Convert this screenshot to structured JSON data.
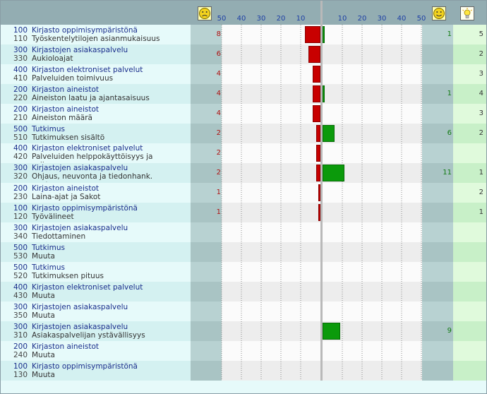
{
  "chart_data": {
    "type": "bar",
    "orientation": "diverging-horizontal",
    "axis_ticks": [
      50,
      40,
      30,
      20,
      10
    ],
    "axis_ticks_right": [
      10,
      20,
      30,
      40,
      50
    ],
    "xlim": [
      0,
      50
    ],
    "legend": {
      "negative": "sad-face-icon",
      "positive": "smiley-face-icon",
      "ideas": "lightbulb-icon"
    },
    "rows": [
      {
        "code1": "100",
        "cat": "Kirjasto oppimisympäristönä",
        "code2": "110",
        "sub": [
          "Työskentelytilojen asianmukaisuus"
        ],
        "neg": 8,
        "pos": 1,
        "ideas": 5
      },
      {
        "code1": "300",
        "cat": "Kirjastojen asiakaspalvelu",
        "code2": "330",
        "sub": [
          "Aukioloajat"
        ],
        "neg": 6,
        "pos": null,
        "ideas": 2
      },
      {
        "code1": "400",
        "cat": "Kirjaston elektroniset palvelut",
        "code2": "410",
        "sub": [
          "Palveluiden toimivuus"
        ],
        "neg": 4,
        "pos": null,
        "ideas": 3
      },
      {
        "code1": "200",
        "cat": "Kirjaston aineistot",
        "code2": "220",
        "sub": [
          "Aineiston laatu ja ajantasaisuus"
        ],
        "neg": 4,
        "pos": 1,
        "ideas": 4
      },
      {
        "code1": "200",
        "cat": "Kirjaston aineistot",
        "code2": "210",
        "sub": [
          "Aineiston määrä"
        ],
        "neg": 4,
        "pos": null,
        "ideas": 3
      },
      {
        "code1": "500",
        "cat": "Tutkimus",
        "code2": "510",
        "sub": [
          "Tutkimuksen sisältö"
        ],
        "neg": 2,
        "pos": 6,
        "ideas": 2
      },
      {
        "code1": "400",
        "cat": "Kirjaston elektroniset palvelut",
        "code2": "420",
        "sub": [
          "Palveluiden helppokäyttöisyys ja",
          "selkeys"
        ],
        "neg": 2,
        "pos": null,
        "ideas": null
      },
      {
        "code1": "300",
        "cat": "Kirjastojen asiakaspalvelu",
        "code2": "320",
        "sub": [
          "Ohjaus, neuvonta ja tiedonhank.",
          "opetus"
        ],
        "neg": 2,
        "pos": 11,
        "ideas": 1
      },
      {
        "code1": "200",
        "cat": "Kirjaston aineistot",
        "code2": "230",
        "sub": [
          "Laina-ajat ja Sakot"
        ],
        "neg": 1,
        "pos": null,
        "ideas": 2
      },
      {
        "code1": "100",
        "cat": "Kirjasto oppimisympäristönä",
        "code2": "120",
        "sub": [
          "Työvälineet"
        ],
        "neg": 1,
        "pos": null,
        "ideas": 1
      },
      {
        "code1": "300",
        "cat": "Kirjastojen asiakaspalvelu",
        "code2": "340",
        "sub": [
          "Tiedottaminen"
        ],
        "neg": null,
        "pos": null,
        "ideas": null
      },
      {
        "code1": "500",
        "cat": "Tutkimus",
        "code2": "530",
        "sub": [
          "Muuta"
        ],
        "neg": null,
        "pos": null,
        "ideas": null
      },
      {
        "code1": "500",
        "cat": "Tutkimus",
        "code2": "520",
        "sub": [
          "Tutkimuksen pituus"
        ],
        "neg": null,
        "pos": null,
        "ideas": null
      },
      {
        "code1": "400",
        "cat": "Kirjaston elektroniset palvelut",
        "code2": "430",
        "sub": [
          "Muuta"
        ],
        "neg": null,
        "pos": null,
        "ideas": null
      },
      {
        "code1": "300",
        "cat": "Kirjastojen asiakaspalvelu",
        "code2": "350",
        "sub": [
          "Muuta"
        ],
        "neg": null,
        "pos": null,
        "ideas": null
      },
      {
        "code1": "300",
        "cat": "Kirjastojen asiakaspalvelu",
        "code2": "310",
        "sub": [
          "Asiakaspalvelijan ystävällisyys"
        ],
        "neg": null,
        "pos": 9,
        "ideas": null
      },
      {
        "code1": "200",
        "cat": "Kirjaston aineistot",
        "code2": "240",
        "sub": [
          "Muuta"
        ],
        "neg": null,
        "pos": null,
        "ideas": null
      },
      {
        "code1": "100",
        "cat": "Kirjasto oppimisympäristönä",
        "code2": "130",
        "sub": [
          "Muuta"
        ],
        "neg": null,
        "pos": null,
        "ideas": null
      }
    ]
  }
}
